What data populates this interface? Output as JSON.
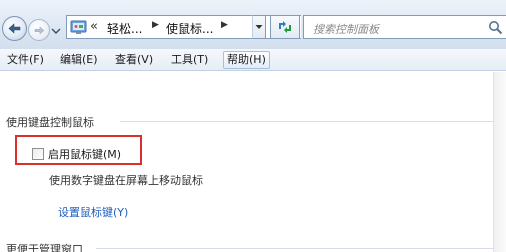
{
  "nav": {
    "back_icon": "back-arrow-icon",
    "forward_icon": "forward-arrow-icon",
    "address": {
      "chevrons": "«",
      "crumbs": [
        "轻松...",
        "使鼠标..."
      ]
    },
    "search": {
      "placeholder": "搜索控制面板"
    }
  },
  "menu": {
    "items": [
      {
        "label": "文件(F)"
      },
      {
        "label": "编辑(E)"
      },
      {
        "label": "查看(V)"
      },
      {
        "label": "工具(T)"
      },
      {
        "label": "帮助(H)"
      }
    ]
  },
  "content": {
    "section_title": "使用键盘控制鼠标",
    "checkbox_label": "启用鼠标键(M)",
    "checkbox_checked": false,
    "description": "使用数字键盘在屏幕上移动鼠标",
    "link": "设置鼠标键(Y)",
    "section_title_2": "更便于管理窗口"
  },
  "colors": {
    "highlight": "#d9302d",
    "link": "#1e5ebd",
    "accent": "#7f9db9"
  }
}
